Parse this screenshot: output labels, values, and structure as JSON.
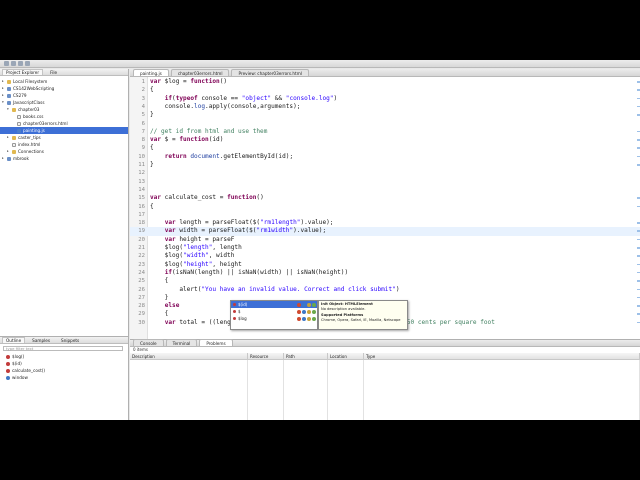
{
  "project_explorer": {
    "tabs": [
      "Project Explorer",
      "File"
    ],
    "tree": [
      {
        "label": "Local Filesystem",
        "indent": 0,
        "icon": "folder-icon",
        "twisty": "▸"
      },
      {
        "label": "CS142WebScripting",
        "indent": 0,
        "icon": "project-icon",
        "twisty": "▸"
      },
      {
        "label": "CS279",
        "indent": 0,
        "icon": "project-icon",
        "twisty": "▸"
      },
      {
        "label": "JavascriptClass",
        "indent": 0,
        "icon": "project-icon",
        "twisty": "▾"
      },
      {
        "label": "chapter03",
        "indent": 1,
        "icon": "folder-icon",
        "twisty": "▾"
      },
      {
        "label": "books.css",
        "indent": 2,
        "icon": "file-icon",
        "twisty": ""
      },
      {
        "label": "chapter03errors.html",
        "indent": 2,
        "icon": "file-icon",
        "twisty": ""
      },
      {
        "label": "painting.js",
        "indent": 2,
        "icon": "js-file-icon",
        "twisty": "",
        "selected": true
      },
      {
        "label": "caster_tips",
        "indent": 1,
        "icon": "folder-icon",
        "twisty": "▸"
      },
      {
        "label": "index.html",
        "indent": 1,
        "icon": "file-icon",
        "twisty": ""
      },
      {
        "label": "Connections",
        "indent": 1,
        "icon": "folder-icon",
        "twisty": "▸"
      },
      {
        "label": "mbrook",
        "indent": 0,
        "icon": "project-icon",
        "twisty": "▸"
      }
    ]
  },
  "outline": {
    "tabs": [
      "Outline",
      "Samples",
      "Snippets"
    ],
    "filter_placeholder": "type filter text",
    "items": [
      {
        "label": "$log()",
        "icon": "red"
      },
      {
        "label": "$(id)",
        "icon": "red"
      },
      {
        "label": "calculate_cost()",
        "icon": "red"
      },
      {
        "label": "window",
        "icon": "blue"
      }
    ]
  },
  "editor": {
    "tabs": [
      {
        "label": "painting.js",
        "active": true
      },
      {
        "label": "chapter03errors.html",
        "active": false
      },
      {
        "label": "Preview: chapter03errors.html",
        "active": false
      }
    ],
    "lines": [
      {
        "n": "1",
        "html": "<span class=\"kw\">var</span> $log = <span class=\"kw\">function</span>()"
      },
      {
        "n": "2",
        "html": "{"
      },
      {
        "n": "3",
        "html": "    <span class=\"kw\">if</span>(<span class=\"kw\">typeof</span> console == <span class=\"str\">\"object\"</span> &amp;&amp; <span class=\"str\">\"console.log\"</span>)"
      },
      {
        "n": "4",
        "html": "    console.<span class=\"fn\">log</span>.apply(console,arguments);"
      },
      {
        "n": "5",
        "html": "}"
      },
      {
        "n": "6",
        "html": ""
      },
      {
        "n": "7",
        "html": "<span class=\"cm\">// get id from html and use them</span>"
      },
      {
        "n": "8",
        "html": "<span class=\"kw\">var</span> $ = <span class=\"kw\">function</span>(id)"
      },
      {
        "n": "9",
        "html": "{"
      },
      {
        "n": "10",
        "html": "    <span class=\"kw\">return</span> <span class=\"fn\">document</span>.getElementById(id);"
      },
      {
        "n": "11",
        "html": "}"
      },
      {
        "n": "12",
        "html": ""
      },
      {
        "n": "13",
        "html": ""
      },
      {
        "n": "14",
        "html": ""
      },
      {
        "n": "15",
        "html": "<span class=\"kw\">var</span> calculate_cost = <span class=\"kw\">function</span>()"
      },
      {
        "n": "16",
        "html": "{"
      },
      {
        "n": "17",
        "html": ""
      },
      {
        "n": "18",
        "html": "    <span class=\"kw\">var</span> length = parseFloat($(<span class=\"str\">\"rm1length\"</span>).value);"
      },
      {
        "n": "19",
        "html": "    <span class=\"kw\">var</span> width = parseFloat($(<span class=\"str\">\"rm1width\"</span>).value);",
        "highlight": true
      },
      {
        "n": "20",
        "html": "    <span class=\"kw\">var</span> height = parseF"
      },
      {
        "n": "21",
        "html": "    $log(<span class=\"str\">\"length\"</span>, length"
      },
      {
        "n": "22",
        "html": "    $log(<span class=\"str\">\"width\"</span>, width"
      },
      {
        "n": "23",
        "html": "    $log(<span class=\"str\">\"height\"</span>, height"
      },
      {
        "n": "24",
        "html": "    <span class=\"kw\">if</span>(isNaN(length) || isNaN(width) || isNaN(height))"
      },
      {
        "n": "25",
        "html": "    {"
      },
      {
        "n": "26",
        "html": "        alert(<span class=\"str\">\"You have an invalid value. Correct and click submit\"</span>)"
      },
      {
        "n": "27",
        "html": "    }"
      },
      {
        "n": "28",
        "html": "    <span class=\"kw\">else</span>"
      },
      {
        "n": "29",
        "html": "    {"
      },
      {
        "n": "30",
        "html": "    <span class=\"kw\">var</span> total = ((length * height * 2) + (width * height * 2)) *.5 ;<span class=\"cm\">//50 cents per square foot</span>"
      }
    ]
  },
  "autocomplete": {
    "items": [
      {
        "label": "$(id)",
        "selected": true
      },
      {
        "label": "$",
        "selected": false
      },
      {
        "label": "$log",
        "selected": false
      }
    ],
    "doc_title": "Init Object: HTMLElement",
    "doc_line": "No description available.",
    "doc_platforms_label": "Supported Platforms",
    "doc_platforms": "Chrome, Opera, Safari, IE, Mozilla, Netscape"
  },
  "bottom": {
    "tabs": [
      {
        "label": "Console",
        "active": false
      },
      {
        "label": "Terminal",
        "active": false
      },
      {
        "label": "Problems",
        "active": true
      }
    ],
    "count": "0 items",
    "columns": [
      "Description",
      "Resource",
      "Path",
      "Location",
      "Type"
    ]
  }
}
